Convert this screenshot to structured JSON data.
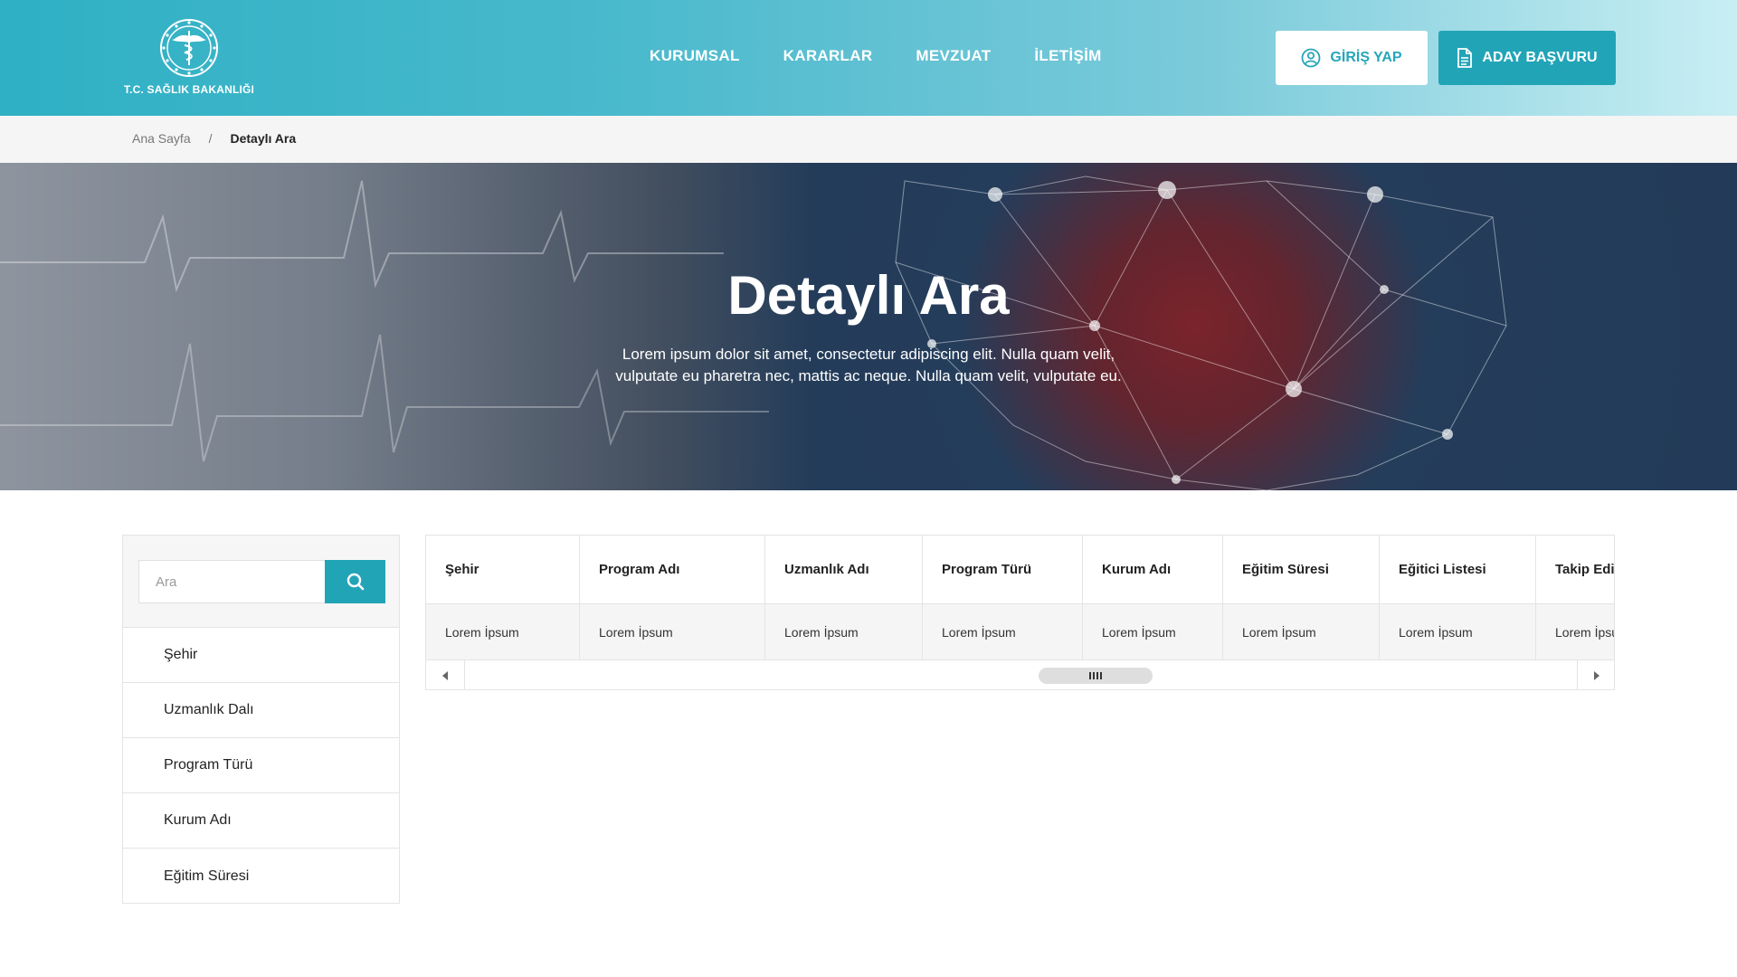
{
  "brand": {
    "name": "T.C. SAĞLIK BAKANLIĞI",
    "logo_icon": "ministry-emblem-icon",
    "accent_color": "#22a4b7"
  },
  "nav": {
    "items": [
      {
        "label": "KURUMSAL"
      },
      {
        "label": "KARARLAR"
      },
      {
        "label": "MEVZUAT"
      },
      {
        "label": "İLETİŞİM"
      }
    ]
  },
  "header_actions": {
    "login": {
      "label": "GİRİŞ YAP",
      "icon": "user-circle-icon"
    },
    "apply": {
      "label": "ADAY BAŞVURU",
      "icon": "document-icon"
    }
  },
  "breadcrumb": {
    "home": "Ana Sayfa",
    "separator": "/",
    "current": "Detaylı Ara"
  },
  "hero": {
    "title": "Detaylı Ara",
    "description": "Lorem ipsum dolor sit amet, consectetur adipiscing elit. Nulla quam velit, vulputate eu pharetra nec, mattis ac neque. Nulla quam velit, vulputate eu."
  },
  "search": {
    "placeholder": "Ara",
    "value": "",
    "button_icon": "search-icon"
  },
  "filters": [
    {
      "label": "Şehir"
    },
    {
      "label": "Uzmanlık Dalı"
    },
    {
      "label": "Program Türü"
    },
    {
      "label": "Kurum Adı"
    },
    {
      "label": "Eğitim Süresi"
    }
  ],
  "table": {
    "columns": [
      "Şehir",
      "Program Adı",
      "Uzmanlık Adı",
      "Program Türü",
      "Kurum Adı",
      "Eğitim Süresi",
      "Eğitici Listesi",
      "Takip Edilen"
    ],
    "rows": [
      [
        "Lorem İpsum",
        "Lorem İpsum",
        "Lorem İpsum",
        "Lorem İpsum",
        "Lorem İpsum",
        "Lorem İpsum",
        "Lorem İpsum",
        "Lorem İpsum"
      ]
    ],
    "scrollbar": {
      "left_icon": "caret-left-icon",
      "right_icon": "caret-right-icon"
    }
  }
}
